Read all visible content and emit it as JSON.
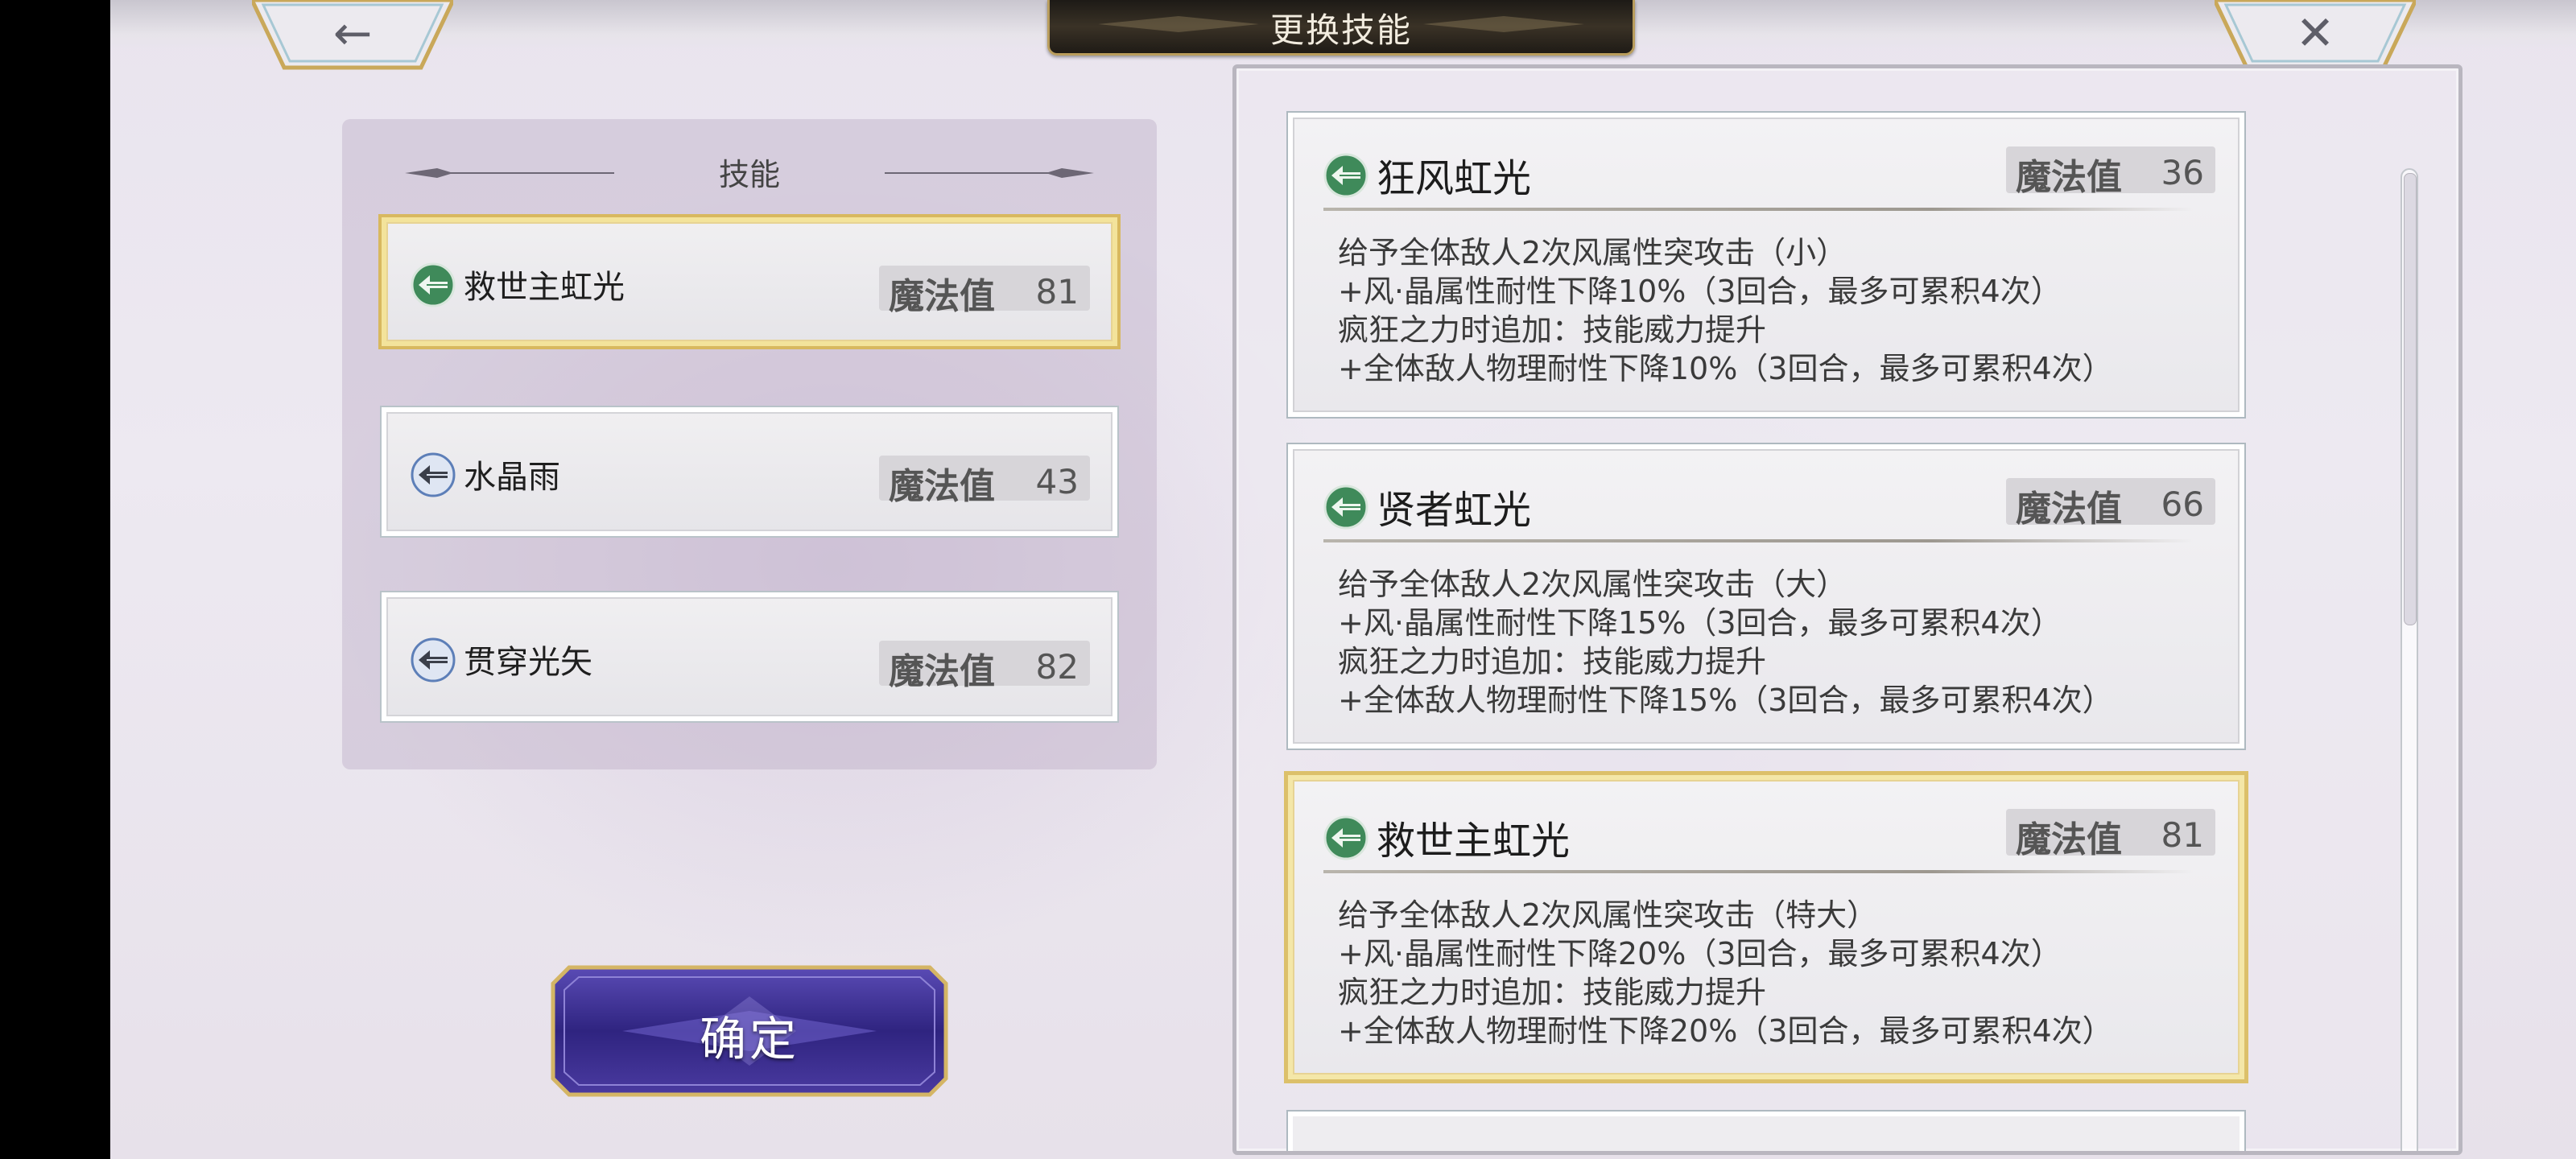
{
  "header": {
    "title": "更换技能",
    "back_icon": "left-arrow-icon",
    "close_icon": "close-x-icon"
  },
  "left_panel": {
    "title": "技能",
    "slots": [
      {
        "name": "救世主虹光",
        "mp_label": "魔法值",
        "mp": "81",
        "selected": true,
        "icon": "wind-arrow-icon-green"
      },
      {
        "name": "水晶雨",
        "mp_label": "魔法值",
        "mp": "43",
        "selected": false,
        "icon": "crystal-arrow-icon-blue"
      },
      {
        "name": "贯穿光矢",
        "mp_label": "魔法值",
        "mp": "82",
        "selected": false,
        "icon": "light-arrow-icon-blue"
      }
    ]
  },
  "confirm_button": {
    "label": "确定"
  },
  "skill_list": [
    {
      "name": "狂风虹光",
      "mp_label": "魔法值",
      "mp": "36",
      "selected": false,
      "icon": "wind-arrow-icon-green",
      "desc": [
        "给予全体敌人2次风属性突攻击（小）",
        "+风·晶属性耐性下降10%（3回合，最多可累积4次）",
        "疯狂之力时追加：技能威力提升",
        "+全体敌人物理耐性下降10%（3回合，最多可累积4次）"
      ]
    },
    {
      "name": "贤者虹光",
      "mp_label": "魔法值",
      "mp": "66",
      "selected": false,
      "icon": "wind-arrow-icon-green",
      "desc": [
        "给予全体敌人2次风属性突攻击（大）",
        "+风·晶属性耐性下降15%（3回合，最多可累积4次）",
        "疯狂之力时追加：技能威力提升",
        "+全体敌人物理耐性下降15%（3回合，最多可累积4次）"
      ]
    },
    {
      "name": "救世主虹光",
      "mp_label": "魔法值",
      "mp": "81",
      "selected": true,
      "icon": "wind-arrow-icon-green",
      "desc": [
        "给予全体敌人2次风属性突攻击（特大）",
        "+风·晶属性耐性下降20%（3回合，最多可累积4次）",
        "疯狂之力时追加：技能威力提升",
        "+全体敌人物理耐性下降20%（3回合，最多可累积4次）"
      ]
    }
  ],
  "colors": {
    "selected_border": "#dcc06a",
    "confirm_bg": "#3b2e8c",
    "wind_icon": "#3f8a5a",
    "crystal_icon": "#5d7fb8"
  }
}
